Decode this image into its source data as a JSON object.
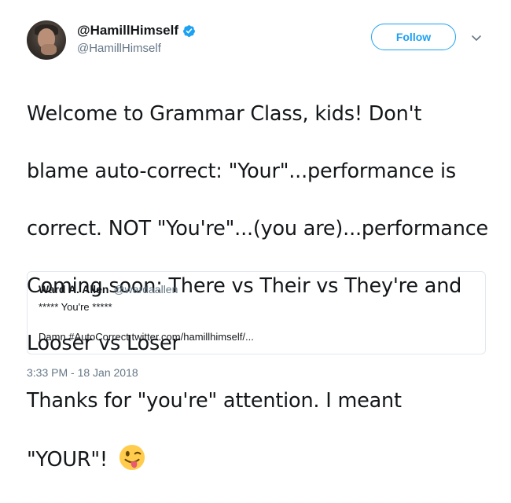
{
  "author": {
    "display_name": "@HamillHimself",
    "handle": "@HamillHimself",
    "verified": true
  },
  "actions": {
    "follow_label": "Follow",
    "menu_icon": "chevron-down-icon"
  },
  "tweet": {
    "lines": [
      "Welcome to Grammar Class, kids! Don't",
      "blame auto-correct: \"Your\"...performance is",
      "correct. NOT \"You're\"...(you are)...performance",
      "Coming soon: There vs Their vs They're and",
      "Looser vs Loser",
      "Thanks for \"you're\" attention. I meant",
      "\"YOUR\"!"
    ],
    "emoji": "winking-face-with-tongue"
  },
  "quoted_tweet": {
    "name": "Ward A. Allen",
    "handle": "@wardaallen",
    "line1": "***** You're *****",
    "line2": "Damn #AutoCorrect twitter.com/hamillhimself/..."
  },
  "timestamp": "3:33 PM - 18 Jan 2018",
  "colors": {
    "accent": "#1da1f2",
    "secondary_text": "#657786",
    "border": "#e1e8ed"
  }
}
